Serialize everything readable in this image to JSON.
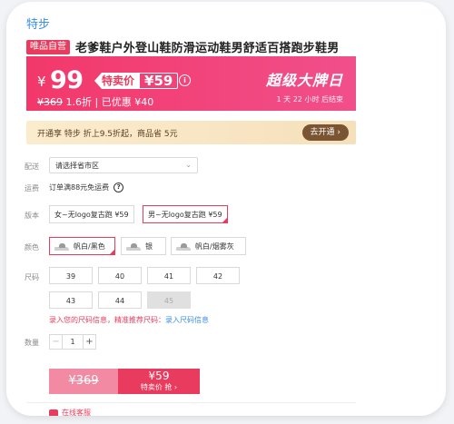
{
  "header": {
    "fragment": "特步"
  },
  "product": {
    "tag": "唯品自营",
    "title": "老爹鞋户外登山鞋防滑运动鞋男舒适百搭跑步鞋男"
  },
  "price": {
    "currency": "¥",
    "current": "99",
    "sale_label": "特卖价",
    "sale_price": "¥59",
    "original": "¥369",
    "discount": "1.6折",
    "saved": "| 已优惠 ¥40",
    "event": "超级大牌日",
    "countdown": "1 天 22 小时 后结束",
    "colors": {
      "banner": "#f2386a",
      "accent": "#e93b5d"
    }
  },
  "vip": {
    "text": "开通享 特步 折上9.5折起，商品省 5元",
    "button": "去开通 ›"
  },
  "labels": {
    "ship_to": "配送",
    "freight": "运费",
    "version": "版本",
    "color": "颜色",
    "size": "尺码",
    "qty": "数量"
  },
  "ship_select": {
    "placeholder": "请选择省市区"
  },
  "freight": {
    "text": "订单满88元免运费"
  },
  "versions": [
    {
      "label": "女~无logo复古跑 ¥59",
      "selected": false
    },
    {
      "label": "男~无logo复古跑 ¥59",
      "selected": true
    }
  ],
  "colors": [
    {
      "label": "帆白/黑色",
      "selected": true
    },
    {
      "label": "银",
      "selected": false
    },
    {
      "label": "帆白/烟雾灰",
      "selected": false
    }
  ],
  "sizes": [
    "39",
    "40",
    "41",
    "42",
    "43",
    "44",
    "45"
  ],
  "size_info": {
    "text": "录入您的尺码信息，精准推荐尺码：",
    "link": "录入尺码信息"
  },
  "quantity": {
    "minus": "−",
    "value": "1",
    "plus": "+"
  },
  "buy": {
    "old_price": "¥369",
    "price": "¥59",
    "label": "特卖价 抢 ›"
  },
  "service": {
    "label": "在线客服"
  }
}
